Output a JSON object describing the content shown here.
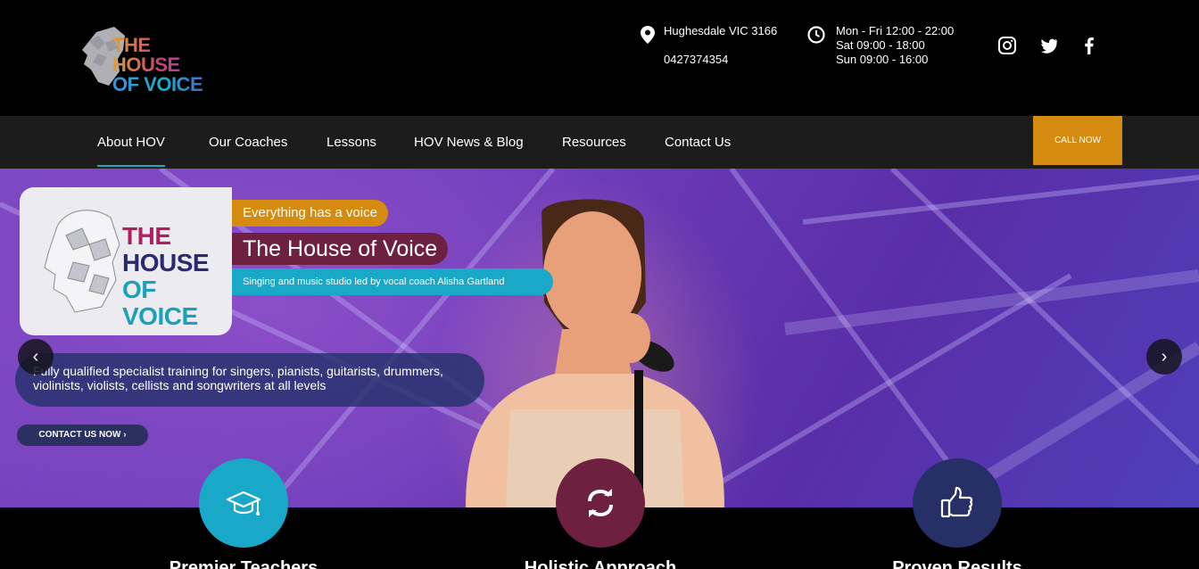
{
  "header": {
    "logo_line1": "THE HOUSE",
    "logo_line2": "OF VOICE",
    "address": "Hughesdale VIC 3166",
    "phone": "0427374354",
    "hours": [
      "Mon - Fri 12:00 - 22:00",
      "Sat 09:00 - 18:00",
      "Sun 09:00 - 16:00"
    ],
    "icons": {
      "location": "map-pin-icon",
      "hours": "clock-icon"
    },
    "social": [
      "instagram-icon",
      "twitter-icon",
      "facebook-icon"
    ]
  },
  "nav": {
    "items": [
      "About HOV",
      "Our Coaches",
      "Lessons",
      "HOV News & Blog",
      "Resources",
      "Contact Us"
    ],
    "active": "About HOV",
    "call_now": "CALL NOW"
  },
  "hero": {
    "card_logo": [
      "THE",
      "HOUSE",
      "OF",
      "VOICE"
    ],
    "tagline": "Everything has a voice",
    "title": "The House of Voice",
    "subtitle": "Singing and music studio led by vocal coach Alisha Gartland",
    "description": "Fully qualified specialist training for singers, pianists, guitarists, drummers, violinists, violists, cellists and songwriters at all levels",
    "cta": "CONTACT US NOW",
    "prev_arrow": "‹",
    "next_arrow": "›"
  },
  "features": [
    {
      "title": "Premier Teachers",
      "icon": "graduation-cap-icon",
      "color": "#1aa8c8"
    },
    {
      "title": "Holistic Approach",
      "icon": "refresh-icon",
      "color": "#6e2040"
    },
    {
      "title": "Proven Results",
      "icon": "thumbs-up-icon",
      "color": "#262f66"
    }
  ],
  "colors": {
    "accent_orange": "#d58a10",
    "accent_teal": "#1aa8c8",
    "accent_maroon": "#6e2040",
    "nav_bg": "#1c1c1c"
  }
}
